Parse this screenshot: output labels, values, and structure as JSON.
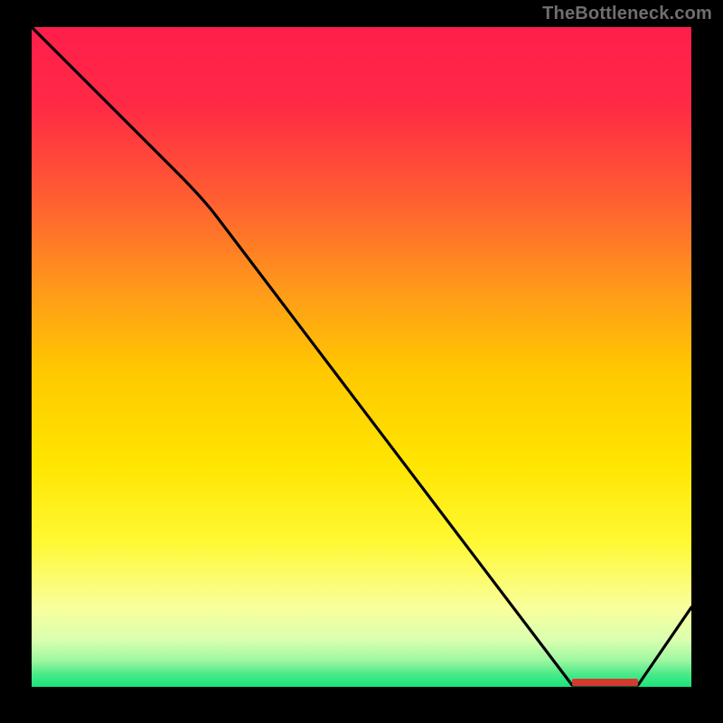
{
  "watermark": "TheBottleneck.com",
  "optimal_label": "",
  "chart_data": {
    "type": "line",
    "title": "",
    "xlabel": "",
    "ylabel": "",
    "x_range": [
      0,
      100
    ],
    "y_range": [
      0,
      100
    ],
    "background": {
      "type": "vertical-gradient",
      "stops": [
        {
          "offset": 0.0,
          "color": "#ff1e4b"
        },
        {
          "offset": 0.25,
          "color": "#ff5a33"
        },
        {
          "offset": 0.5,
          "color": "#ffc400"
        },
        {
          "offset": 0.72,
          "color": "#fff600"
        },
        {
          "offset": 0.9,
          "color": "#f6ffb0"
        },
        {
          "offset": 0.96,
          "color": "#c8ff9a"
        },
        {
          "offset": 1.0,
          "color": "#18e47a"
        }
      ]
    },
    "series": [
      {
        "name": "bottleneck-curve",
        "color": "#000000",
        "points": [
          {
            "x": 0,
            "y": 100
          },
          {
            "x": 22,
            "y": 78
          },
          {
            "x": 28,
            "y": 72
          },
          {
            "x": 82,
            "y": 0
          },
          {
            "x": 92,
            "y": 0
          },
          {
            "x": 100,
            "y": 12
          }
        ]
      }
    ],
    "optimal_range_x": [
      82,
      92
    ]
  }
}
